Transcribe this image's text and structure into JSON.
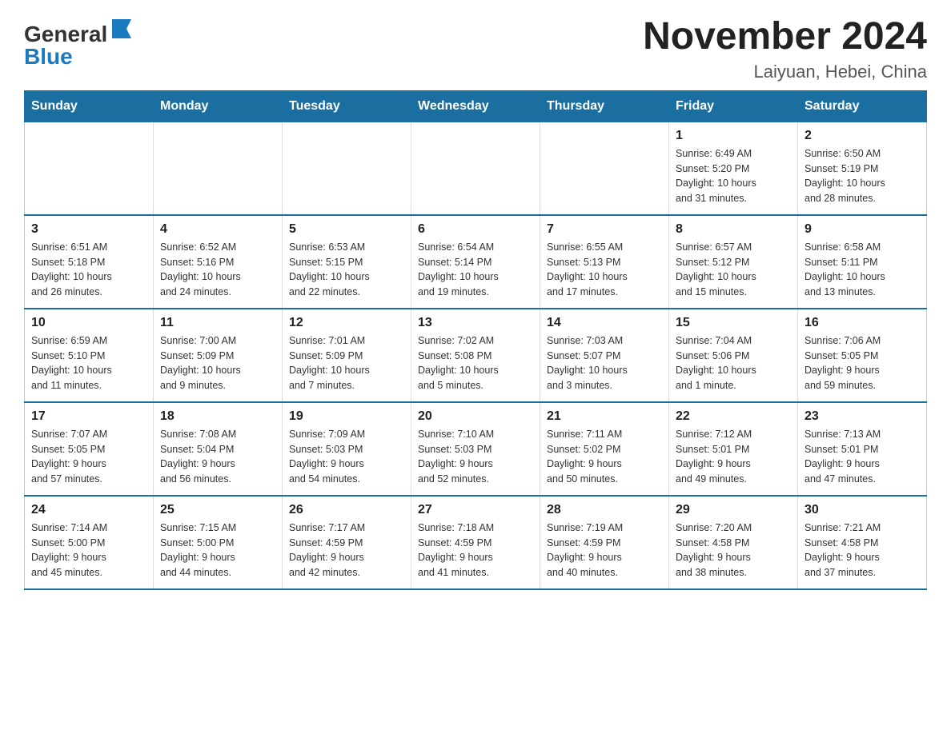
{
  "header": {
    "logo_general": "General",
    "logo_blue": "Blue",
    "title": "November 2024",
    "subtitle": "Laiyuan, Hebei, China"
  },
  "weekdays": [
    "Sunday",
    "Monday",
    "Tuesday",
    "Wednesday",
    "Thursday",
    "Friday",
    "Saturday"
  ],
  "weeks": [
    [
      {
        "day": "",
        "info": ""
      },
      {
        "day": "",
        "info": ""
      },
      {
        "day": "",
        "info": ""
      },
      {
        "day": "",
        "info": ""
      },
      {
        "day": "",
        "info": ""
      },
      {
        "day": "1",
        "info": "Sunrise: 6:49 AM\nSunset: 5:20 PM\nDaylight: 10 hours\nand 31 minutes."
      },
      {
        "day": "2",
        "info": "Sunrise: 6:50 AM\nSunset: 5:19 PM\nDaylight: 10 hours\nand 28 minutes."
      }
    ],
    [
      {
        "day": "3",
        "info": "Sunrise: 6:51 AM\nSunset: 5:18 PM\nDaylight: 10 hours\nand 26 minutes."
      },
      {
        "day": "4",
        "info": "Sunrise: 6:52 AM\nSunset: 5:16 PM\nDaylight: 10 hours\nand 24 minutes."
      },
      {
        "day": "5",
        "info": "Sunrise: 6:53 AM\nSunset: 5:15 PM\nDaylight: 10 hours\nand 22 minutes."
      },
      {
        "day": "6",
        "info": "Sunrise: 6:54 AM\nSunset: 5:14 PM\nDaylight: 10 hours\nand 19 minutes."
      },
      {
        "day": "7",
        "info": "Sunrise: 6:55 AM\nSunset: 5:13 PM\nDaylight: 10 hours\nand 17 minutes."
      },
      {
        "day": "8",
        "info": "Sunrise: 6:57 AM\nSunset: 5:12 PM\nDaylight: 10 hours\nand 15 minutes."
      },
      {
        "day": "9",
        "info": "Sunrise: 6:58 AM\nSunset: 5:11 PM\nDaylight: 10 hours\nand 13 minutes."
      }
    ],
    [
      {
        "day": "10",
        "info": "Sunrise: 6:59 AM\nSunset: 5:10 PM\nDaylight: 10 hours\nand 11 minutes."
      },
      {
        "day": "11",
        "info": "Sunrise: 7:00 AM\nSunset: 5:09 PM\nDaylight: 10 hours\nand 9 minutes."
      },
      {
        "day": "12",
        "info": "Sunrise: 7:01 AM\nSunset: 5:09 PM\nDaylight: 10 hours\nand 7 minutes."
      },
      {
        "day": "13",
        "info": "Sunrise: 7:02 AM\nSunset: 5:08 PM\nDaylight: 10 hours\nand 5 minutes."
      },
      {
        "day": "14",
        "info": "Sunrise: 7:03 AM\nSunset: 5:07 PM\nDaylight: 10 hours\nand 3 minutes."
      },
      {
        "day": "15",
        "info": "Sunrise: 7:04 AM\nSunset: 5:06 PM\nDaylight: 10 hours\nand 1 minute."
      },
      {
        "day": "16",
        "info": "Sunrise: 7:06 AM\nSunset: 5:05 PM\nDaylight: 9 hours\nand 59 minutes."
      }
    ],
    [
      {
        "day": "17",
        "info": "Sunrise: 7:07 AM\nSunset: 5:05 PM\nDaylight: 9 hours\nand 57 minutes."
      },
      {
        "day": "18",
        "info": "Sunrise: 7:08 AM\nSunset: 5:04 PM\nDaylight: 9 hours\nand 56 minutes."
      },
      {
        "day": "19",
        "info": "Sunrise: 7:09 AM\nSunset: 5:03 PM\nDaylight: 9 hours\nand 54 minutes."
      },
      {
        "day": "20",
        "info": "Sunrise: 7:10 AM\nSunset: 5:03 PM\nDaylight: 9 hours\nand 52 minutes."
      },
      {
        "day": "21",
        "info": "Sunrise: 7:11 AM\nSunset: 5:02 PM\nDaylight: 9 hours\nand 50 minutes."
      },
      {
        "day": "22",
        "info": "Sunrise: 7:12 AM\nSunset: 5:01 PM\nDaylight: 9 hours\nand 49 minutes."
      },
      {
        "day": "23",
        "info": "Sunrise: 7:13 AM\nSunset: 5:01 PM\nDaylight: 9 hours\nand 47 minutes."
      }
    ],
    [
      {
        "day": "24",
        "info": "Sunrise: 7:14 AM\nSunset: 5:00 PM\nDaylight: 9 hours\nand 45 minutes."
      },
      {
        "day": "25",
        "info": "Sunrise: 7:15 AM\nSunset: 5:00 PM\nDaylight: 9 hours\nand 44 minutes."
      },
      {
        "day": "26",
        "info": "Sunrise: 7:17 AM\nSunset: 4:59 PM\nDaylight: 9 hours\nand 42 minutes."
      },
      {
        "day": "27",
        "info": "Sunrise: 7:18 AM\nSunset: 4:59 PM\nDaylight: 9 hours\nand 41 minutes."
      },
      {
        "day": "28",
        "info": "Sunrise: 7:19 AM\nSunset: 4:59 PM\nDaylight: 9 hours\nand 40 minutes."
      },
      {
        "day": "29",
        "info": "Sunrise: 7:20 AM\nSunset: 4:58 PM\nDaylight: 9 hours\nand 38 minutes."
      },
      {
        "day": "30",
        "info": "Sunrise: 7:21 AM\nSunset: 4:58 PM\nDaylight: 9 hours\nand 37 minutes."
      }
    ]
  ]
}
